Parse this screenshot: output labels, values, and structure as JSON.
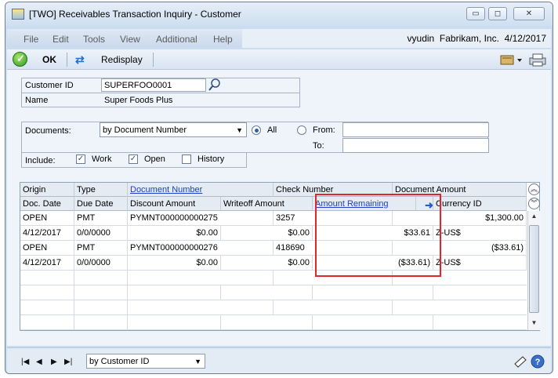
{
  "window": {
    "title": "[TWO] Receivables Transaction Inquiry - Customer",
    "minimize": "▭",
    "restore": "◻",
    "close": "✕"
  },
  "menu": {
    "items": [
      "File",
      "Edit",
      "Tools",
      "View",
      "Additional",
      "Help"
    ],
    "user": "vyudin",
    "company": "Fabrikam, Inc.",
    "date": "4/12/2017"
  },
  "toolbar": {
    "ok_label": "OK",
    "redisplay_label": "Redisplay"
  },
  "form": {
    "customer_id_label": "Customer ID",
    "customer_id_value": "SUPERFOO0001",
    "name_label": "Name",
    "name_value": "Super Foods Plus",
    "documents_label": "Documents:",
    "documents_sort_value": "by Document Number",
    "radio_all_label": "All",
    "radio_from_label": "From:",
    "to_label": "To:",
    "include_label": "Include:",
    "include_work_label": "Work",
    "include_open_label": "Open",
    "include_history_label": "History"
  },
  "grid": {
    "header1": [
      "Origin",
      "Type",
      "Document Number",
      "Check Number",
      "Document Amount"
    ],
    "header2": [
      "Doc. Date",
      "Due Date",
      "Discount Amount",
      "Writeoff Amount",
      "Amount Remaining",
      "Currency ID"
    ],
    "rows": [
      {
        "kind": "primary",
        "c1": "OPEN",
        "c2": "PMT",
        "c3": "PYMNT000000000275",
        "c4": "3257",
        "c5": "",
        "c6": "$1,300.00"
      },
      {
        "kind": "secondary",
        "c1": "4/12/2017",
        "c2": "0/0/0000",
        "c3": "$0.00",
        "c4": "$0.00",
        "c5": "$33.61",
        "c6": "Z-US$"
      },
      {
        "kind": "primary",
        "c1": "OPEN",
        "c2": "PMT",
        "c3": "PYMNT000000000276",
        "c4": "418690",
        "c5": "",
        "c6": "($33.61)"
      },
      {
        "kind": "secondary",
        "c1": "4/12/2017",
        "c2": "0/0/0000",
        "c3": "$0.00",
        "c4": "$0.00",
        "c5": "($33.61)",
        "c6": "Z-US$"
      }
    ]
  },
  "statusbar": {
    "sort_value": "by Customer ID"
  },
  "colors": {
    "highlight": "#e0262a",
    "link": "#1d3ec9",
    "window_frame": "#c9dcf0"
  }
}
